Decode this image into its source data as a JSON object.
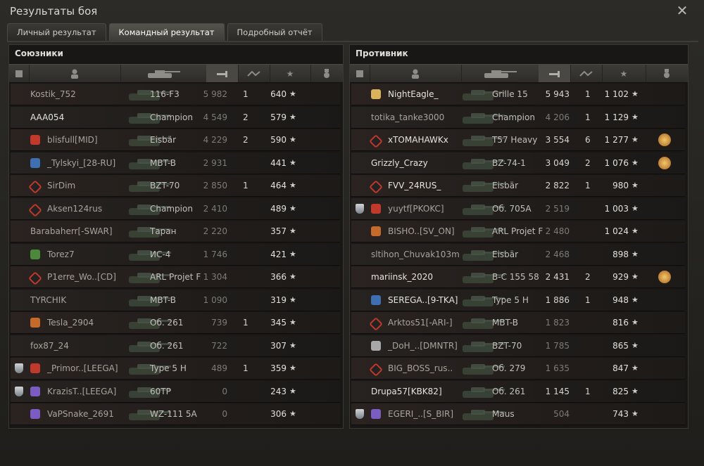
{
  "window": {
    "title": "Результаты боя",
    "close_icon": "close-icon"
  },
  "tabs": [
    {
      "label": "Личный результат",
      "active": false
    },
    {
      "label": "Командный результат",
      "active": true
    },
    {
      "label": "Подробный отчёт",
      "active": false
    }
  ],
  "allies": {
    "title": "Союзники",
    "rows": [
      {
        "name": "Kostik_752",
        "tank": "116-F3",
        "damage": "5 982",
        "kills": "1",
        "xp": "640",
        "highlight": false,
        "platoon": false,
        "clan": "none"
      },
      {
        "name": "AAA054",
        "tank": "Champion",
        "damage": "4 549",
        "kills": "2",
        "xp": "579",
        "highlight": true,
        "platoon": false,
        "clan": "none"
      },
      {
        "name": "blisfull[MID]",
        "tank": "Eisbär",
        "damage": "4 229",
        "kills": "2",
        "xp": "590",
        "highlight": false,
        "platoon": false,
        "clan": "red"
      },
      {
        "name": "_Tylskyi_[28-RU]",
        "tank": "MBT-B",
        "damage": "2 931",
        "kills": "",
        "xp": "441",
        "highlight": false,
        "platoon": false,
        "clan": "blue"
      },
      {
        "name": "SirDim",
        "tank": "BZT-70",
        "damage": "2 850",
        "kills": "1",
        "xp": "464",
        "highlight": false,
        "platoon": false,
        "clan": "diamond"
      },
      {
        "name": "Aksen124rus",
        "tank": "Champion",
        "damage": "2 410",
        "kills": "",
        "xp": "489",
        "highlight": false,
        "platoon": false,
        "clan": "diamond"
      },
      {
        "name": "Barabaherr[-SWAR]",
        "tank": "Таран",
        "damage": "2 220",
        "kills": "",
        "xp": "357",
        "highlight": false,
        "platoon": false,
        "clan": "none"
      },
      {
        "name": "Torez7",
        "tank": "ИС-4",
        "damage": "1 746",
        "kills": "",
        "xp": "421",
        "highlight": false,
        "platoon": false,
        "clan": "green"
      },
      {
        "name": "P1erre_Wo..[CD]",
        "tank": "ARL Projet F",
        "damage": "1 304",
        "kills": "",
        "xp": "366",
        "highlight": false,
        "platoon": false,
        "clan": "diamond"
      },
      {
        "name": "TYRCHIK",
        "tank": "MBT-B",
        "damage": "1 090",
        "kills": "",
        "xp": "319",
        "highlight": false,
        "platoon": false,
        "clan": "none"
      },
      {
        "name": "Tesla_2904",
        "tank": "Об. 261",
        "damage": "739",
        "kills": "1",
        "xp": "345",
        "highlight": false,
        "platoon": false,
        "clan": "orange"
      },
      {
        "name": "fox87_24",
        "tank": "Об. 261",
        "damage": "722",
        "kills": "",
        "xp": "307",
        "highlight": false,
        "platoon": false,
        "clan": "none"
      },
      {
        "name": "_Primor..[LEEGA]",
        "tank": "Type 5 H",
        "damage": "489",
        "kills": "1",
        "xp": "359",
        "highlight": false,
        "platoon": true,
        "clan": "red"
      },
      {
        "name": "KrazisT..[LEEGA]",
        "tank": "60TP",
        "damage": "0",
        "kills": "",
        "xp": "243",
        "highlight": false,
        "platoon": true,
        "clan": "purple"
      },
      {
        "name": "VaPSnake_2691",
        "tank": "WZ-111 5A",
        "damage": "0",
        "kills": "",
        "xp": "306",
        "highlight": false,
        "platoon": false,
        "clan": "purple"
      }
    ]
  },
  "enemies": {
    "title": "Противник",
    "rows": [
      {
        "name": "NightEagle_",
        "tank": "Grille 15",
        "damage": "5 943",
        "kills": "1",
        "xp": "1 102",
        "bright": true,
        "platoon": false,
        "clan": "gold",
        "medal": false
      },
      {
        "name": "totika_tanke3000",
        "tank": "Champion",
        "damage": "4 206",
        "kills": "1",
        "xp": "1 129",
        "bright": false,
        "platoon": false,
        "clan": "none",
        "medal": false
      },
      {
        "name": "xTOMAHAWKx",
        "tank": "T57 Heavy",
        "damage": "3 554",
        "kills": "6",
        "xp": "1 277",
        "bright": true,
        "platoon": false,
        "clan": "diamond",
        "medal": true
      },
      {
        "name": "Grizzly_Crazy",
        "tank": "BZ-74-1",
        "damage": "3 049",
        "kills": "2",
        "xp": "1 076",
        "bright": true,
        "platoon": false,
        "clan": "none",
        "medal": true
      },
      {
        "name": "FVV_24RUS_",
        "tank": "Eisbär",
        "damage": "2 822",
        "kills": "1",
        "xp": "980",
        "bright": true,
        "platoon": false,
        "clan": "diamond",
        "medal": false
      },
      {
        "name": "yuytf[PKOKC]",
        "tank": "Об. 705А",
        "damage": "2 519",
        "kills": "",
        "xp": "1 003",
        "bright": false,
        "platoon": true,
        "clan": "red",
        "medal": false
      },
      {
        "name": "BISHO..[SV_ON]",
        "tank": "ARL Projet F",
        "damage": "2 480",
        "kills": "",
        "xp": "1 024",
        "bright": false,
        "platoon": false,
        "clan": "orange",
        "medal": false
      },
      {
        "name": "sltihon_Chuvak103m",
        "tank": "Eisbär",
        "damage": "2 468",
        "kills": "",
        "xp": "898",
        "bright": false,
        "platoon": false,
        "clan": "none",
        "medal": false
      },
      {
        "name": "mariinsk_2020",
        "tank": "B-C 155 58",
        "damage": "2 431",
        "kills": "2",
        "xp": "929",
        "bright": true,
        "platoon": false,
        "clan": "none",
        "medal": true
      },
      {
        "name": "SEREGA..[9-TKA]",
        "tank": "Type 5 H",
        "damage": "1 886",
        "kills": "1",
        "xp": "948",
        "bright": true,
        "platoon": false,
        "clan": "blue",
        "medal": false
      },
      {
        "name": "Arktos51[-ARI-]",
        "tank": "MBT-B",
        "damage": "1 823",
        "kills": "",
        "xp": "816",
        "bright": false,
        "platoon": false,
        "clan": "diamond",
        "medal": false
      },
      {
        "name": "_DoH_..[DMNTR]",
        "tank": "BZT-70",
        "damage": "1 785",
        "kills": "",
        "xp": "865",
        "bright": false,
        "platoon": false,
        "clan": "silver",
        "medal": false
      },
      {
        "name": "BIG_BOSS_rus..",
        "tank": "Об. 279",
        "damage": "1 635",
        "kills": "",
        "xp": "847",
        "bright": false,
        "platoon": false,
        "clan": "diamond",
        "medal": false
      },
      {
        "name": "Drupa57[KBK82]",
        "tank": "Об. 261",
        "damage": "1 145",
        "kills": "1",
        "xp": "825",
        "bright": true,
        "platoon": false,
        "clan": "none",
        "medal": false
      },
      {
        "name": "EGERI_..[S_BIR]",
        "tank": "Maus",
        "damage": "504",
        "kills": "",
        "xp": "743",
        "bright": false,
        "platoon": true,
        "clan": "purple",
        "medal": false
      }
    ]
  },
  "columns": [
    "platoon-icon",
    "player-icon",
    "tank-icon",
    "damage-icon",
    "kills-icon",
    "xp-star-icon",
    "medal-icon"
  ],
  "colors": {
    "accent": "#c9a16a",
    "highlight_row": "#5a3a2c"
  }
}
